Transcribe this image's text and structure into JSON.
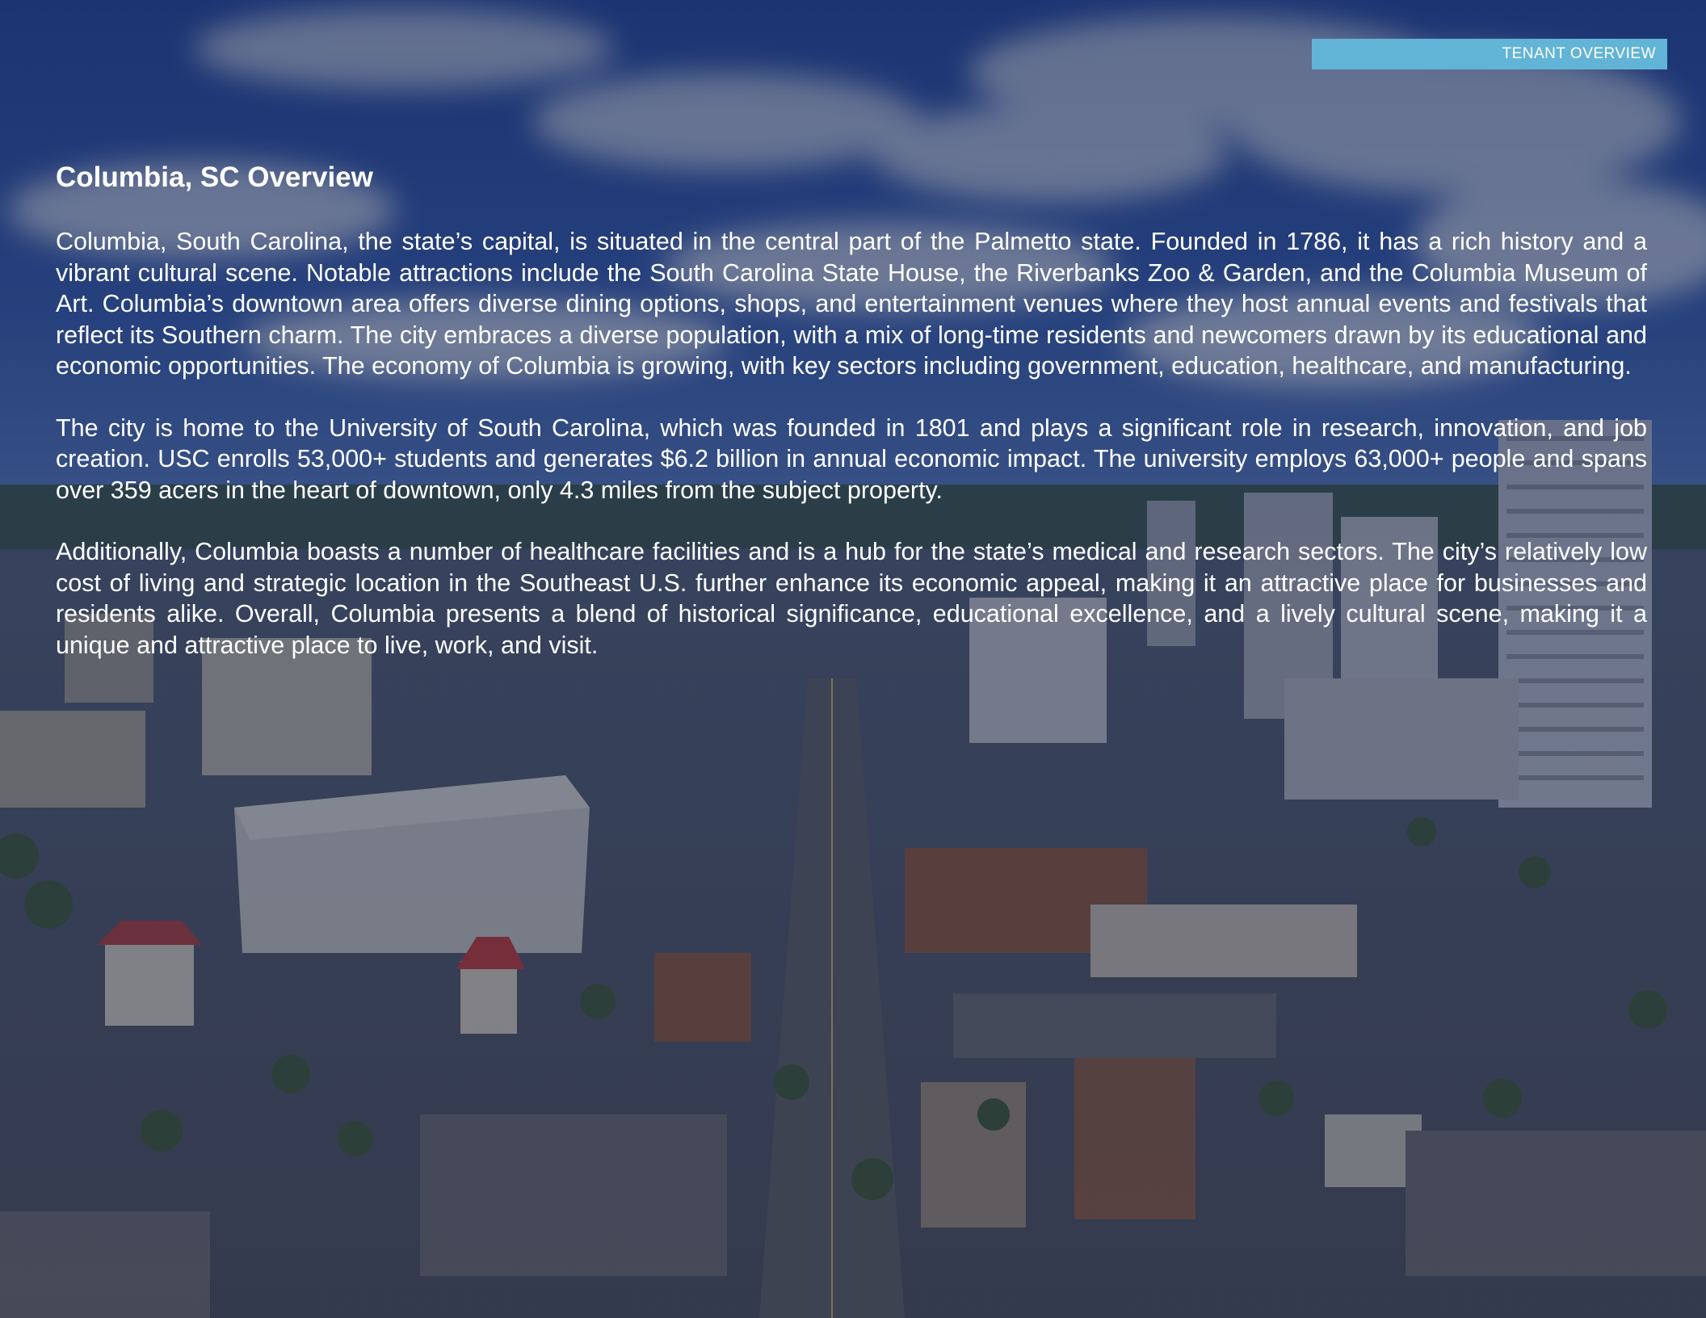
{
  "header": {
    "tag_label": "TENANT OVERVIEW"
  },
  "article": {
    "title": "Columbia, SC Overview",
    "paragraphs": [
      "Columbia, South Carolina, the state’s capital, is situated in the central part of the Palmetto state. Founded in 1786, it has a rich history and a vibrant cultural scene. Notable attractions include the South Carolina State House, the Riverbanks Zoo & Garden, and the Columbia Museum of Art. Columbia’s downtown area offers diverse dining options, shops, and entertainment venues where they host annual events and festivals that reflect its Southern charm. The city embraces a diverse population, with a mix of long-time residents and newcomers drawn by its educational and economic opportunities. The economy of Columbia is growing, with key sectors including government, education, healthcare, and manufacturing.",
      "The city is home to the University of South Carolina, which was founded in 1801 and plays a significant role in research, innovation, and job creation. USC enrolls 53,000+ students and generates $6.2 billion in annual economic impact. The university employs 63,000+ people and spans over 359 acers in the heart of downtown, only 4.3 miles from the subject property.",
      "Additionally, Columbia boasts a number of healthcare facilities and is a hub for the state’s medical and research sectors. The city’s relatively low cost of living and strategic location in the Southeast U.S. further enhance its economic appeal, making it an attractive place for businesses and residents alike. Overall, Columbia presents a blend of historical significance, educational excellence, and a lively cultural scene, making it a unique and attractive place to live, work, and visit."
    ]
  },
  "colors": {
    "tag_background": "#62b4d6",
    "text": "#ffffff",
    "overlay": "#142343"
  }
}
